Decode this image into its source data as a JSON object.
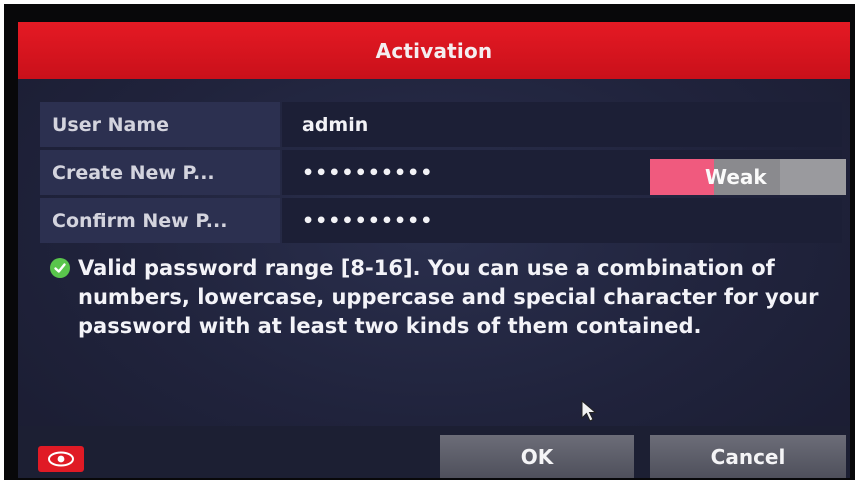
{
  "dialog": {
    "title": "Activation",
    "fields": [
      {
        "label": "User Name",
        "value": "admin"
      },
      {
        "label": "Create New P...",
        "value": "••••••••••"
      },
      {
        "label": "Confirm New P...",
        "value": "••••••••••"
      }
    ],
    "strength": {
      "label": "Weak",
      "level": 1,
      "levels": 3,
      "color_active": "#f05a7e"
    },
    "hint": "Valid password range [8-16]. You can use a combination of numbers, lowercase, uppercase and special character for your password with at least two kinds of them contained.",
    "buttons": {
      "ok": "OK",
      "cancel": "Cancel"
    }
  },
  "colors": {
    "title_bar": "#e51a24",
    "background": "#20233c",
    "accent_ok": "#59c54c"
  },
  "icons": [
    "check-icon",
    "eye-icon",
    "cursor-icon"
  ]
}
